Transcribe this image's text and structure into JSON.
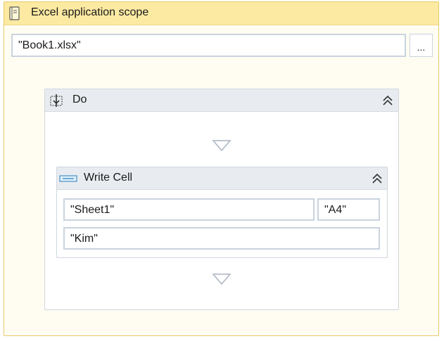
{
  "scope": {
    "title": "Excel application scope",
    "icon": "excel-book-icon",
    "path_value": "\"Book1.xlsx\"",
    "browse_label": "..."
  },
  "do": {
    "title": "Do",
    "icon": "sequence-icon",
    "collapse_icon": "double-chevron-up-icon",
    "drop_icon": "drop-target-arrow-icon"
  },
  "write_cell": {
    "title": "Write Cell",
    "icon": "write-cell-icon",
    "sheet_value": "\"Sheet1\"",
    "range_value": "\"A4\"",
    "value_value": "\"Kim\""
  },
  "colors": {
    "scope_header": "#fdeaa2",
    "scope_border": "#e8c96a",
    "activity_header": "#e8ecf0",
    "field_border": "#c9d3de"
  }
}
